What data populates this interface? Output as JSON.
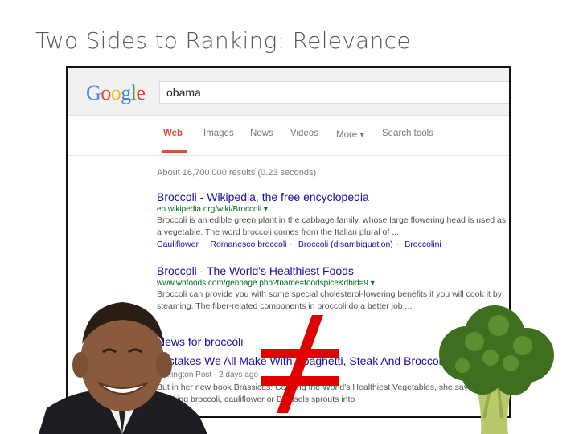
{
  "slide": {
    "title": "Two Sides to Ranking: Relevance"
  },
  "google": {
    "logo_letters": [
      {
        "ch": "G",
        "color": "#4285f4"
      },
      {
        "ch": "o",
        "color": "#ea4335"
      },
      {
        "ch": "o",
        "color": "#fbbc05"
      },
      {
        "ch": "g",
        "color": "#4285f4"
      },
      {
        "ch": "l",
        "color": "#34a853"
      },
      {
        "ch": "e",
        "color": "#ea4335"
      }
    ],
    "query": "obama",
    "tabs": [
      "Web",
      "Images",
      "News",
      "Videos",
      "More ▾",
      "Search tools"
    ],
    "stats": "About 16,700,000 results (0.23 seconds)",
    "results": [
      {
        "title": "Broccoli - Wikipedia, the free encyclopedia",
        "url": "en.wikipedia.org/wiki/Broccoli ▾",
        "snippet": "Broccoli is an edible green plant in the cabbage family, whose large flowering head is used as a vegetable. The word broccoli comes from the Italian plural of ...",
        "links": [
          "Cauliflower",
          "Romanesco broccoli",
          "Broccoli (disambiguation)",
          "Broccolini"
        ]
      },
      {
        "title": "Broccoli - The World's Healthiest Foods",
        "url": "www.whfoods.com/genpage.php?tname=foodspice&dbid=9 ▾",
        "snippet": "Broccoli can provide you with some special cholesterol-lowering benefits if you will cook it by steaming. The fiber-related components in broccoli do a better job ..."
      }
    ],
    "news": {
      "heading": "News for broccoli",
      "title": "Mistakes We All Make With Spaghetti, Steak And Broccoli",
      "source": "Huffington Post - 2 days ago",
      "snippet": "But in her new book Brassicas: Cooking the World's Healthiest Vegetables, she says plunking broccoli, cauliflower or Brussels sprouts into"
    }
  },
  "overlay": {
    "symbol": "≠",
    "symbol_color": "#e00000"
  }
}
